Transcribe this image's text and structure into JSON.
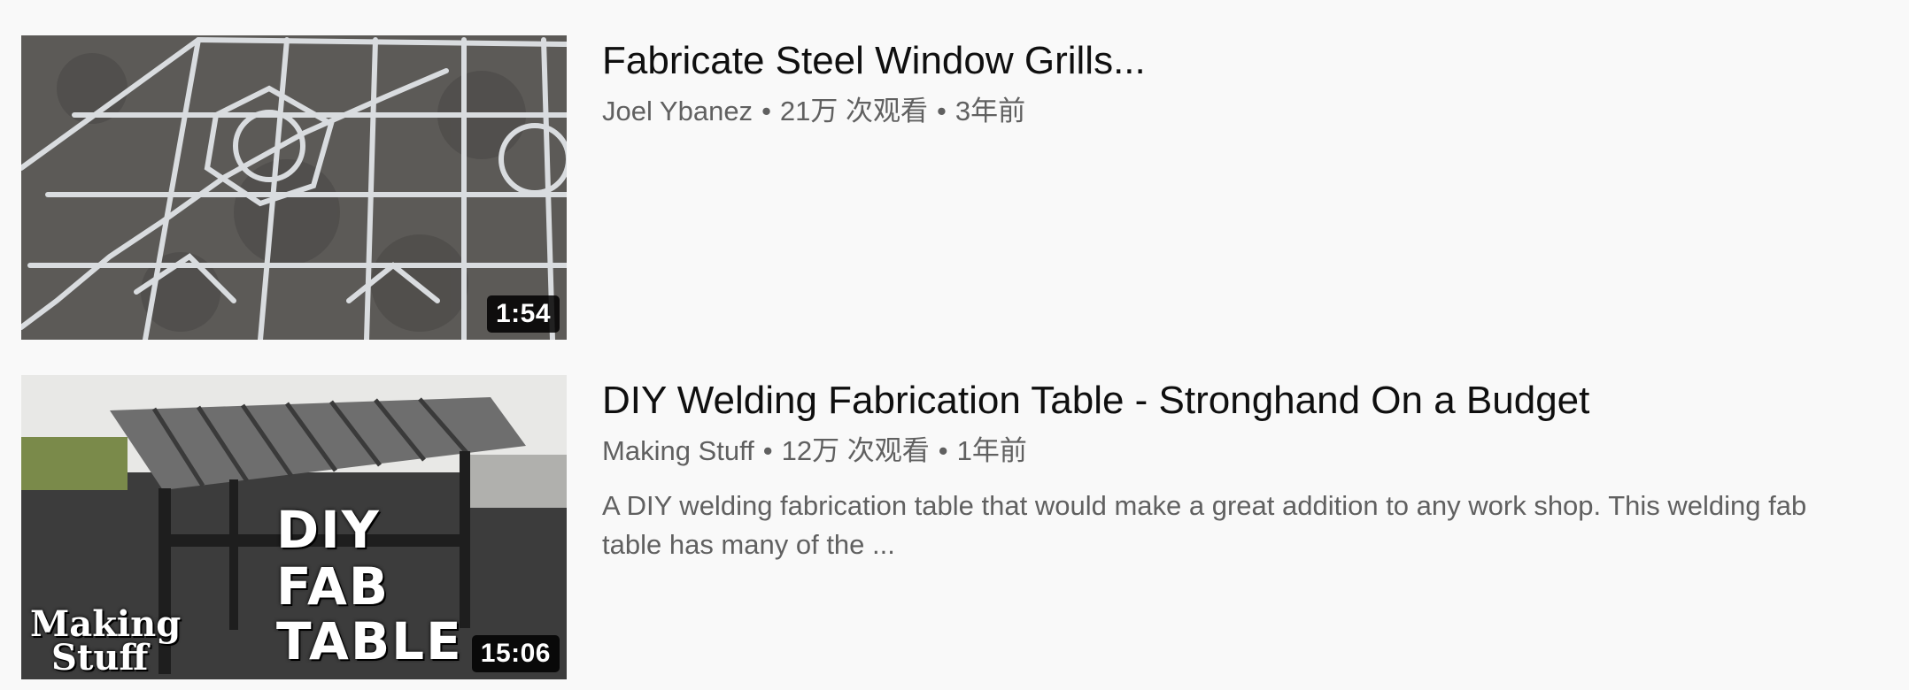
{
  "results": [
    {
      "title": "Fabricate Steel Window Grills...",
      "channel": "Joel Ybanez",
      "views": "21万 次观看",
      "age": "3年前",
      "duration": "1:54",
      "separator": "•"
    },
    {
      "title": "DIY Welding Fabrication Table - Stronghand On a Budget",
      "channel": "Making Stuff",
      "views": "12万 次观看",
      "age": "1年前",
      "duration": "15:06",
      "separator": "•",
      "description": "A DIY welding fabrication table that would make a great addition to any work shop. This welding fab table has many of the ...",
      "thumb_text": {
        "line1": "DIY",
        "line2": "FAB",
        "line3": "TABLE",
        "logo1": "Making",
        "logo2": "Stuff"
      }
    }
  ]
}
